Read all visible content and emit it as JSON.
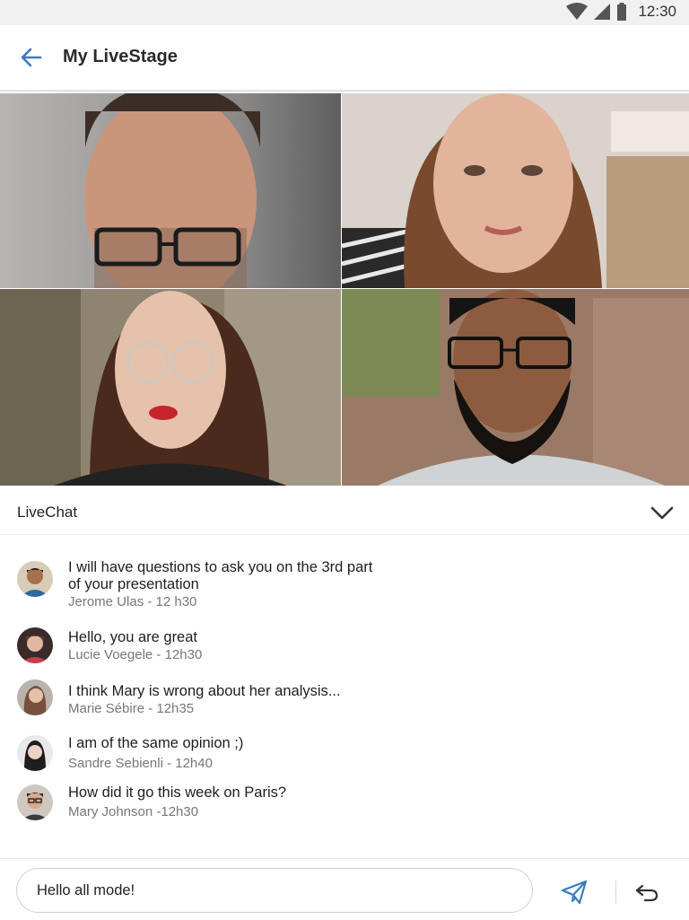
{
  "status_bar": {
    "time": "12:30",
    "icons": [
      "wifi-icon",
      "signal-icon",
      "battery-icon"
    ]
  },
  "header": {
    "title": "My LiveStage",
    "back_icon": "arrow-left-icon"
  },
  "video_grid": {
    "participants": [
      "participant-1",
      "participant-2",
      "participant-3",
      "participant-4"
    ]
  },
  "livechat": {
    "title": "LiveChat",
    "collapse_icon": "chevron-down-icon",
    "messages": [
      {
        "text": "I will have questions to ask you on the 3rd part of your presentation",
        "meta": "Jerome Ulas - 12 h30"
      },
      {
        "text": "Hello, you are great",
        "meta": "Lucie Voegele - 12h30"
      },
      {
        "text": "I think Mary is wrong about her analysis...",
        "meta": "Marie Sébire - 12h35"
      },
      {
        "text": "I am of the same opinion ;)",
        "meta": "Sandre Sebienli  - 12h40"
      },
      {
        "text": "How did it go this week on Paris?",
        "meta": "Mary Johnson -12h30"
      }
    ]
  },
  "composer": {
    "input_value": "Hello all mode!",
    "send_icon": "paper-plane-icon",
    "undo_icon": "undo-icon"
  },
  "colors": {
    "accent": "#3a7bbf",
    "status_bar": "#f1f1f1",
    "meta_text": "#777777"
  }
}
